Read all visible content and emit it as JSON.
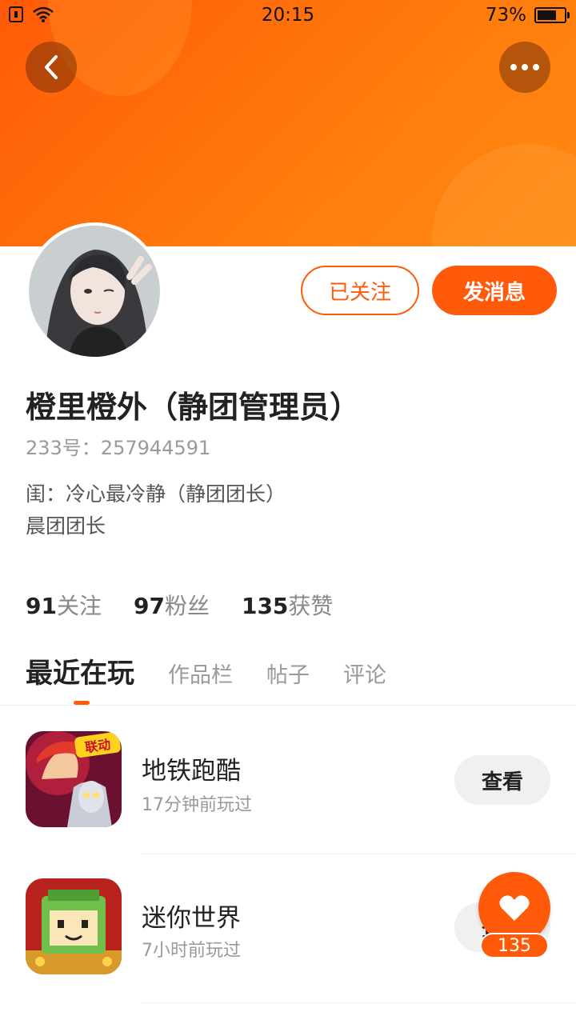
{
  "status_bar": {
    "time": "20:15",
    "battery": "73%",
    "battery_level": 0.73
  },
  "profile": {
    "name": "橙里橙外（静团管理员）",
    "uid": "233号：257944591",
    "bio_line1": "闺：冷心最冷静（静团团长）",
    "bio_line2": "晨团团长",
    "follow_button": "已关注",
    "message_button": "发消息"
  },
  "stats": [
    {
      "num": "91",
      "label": "关注"
    },
    {
      "num": "97",
      "label": "粉丝"
    },
    {
      "num": "135",
      "label": "获赞"
    }
  ],
  "tabs": [
    "最近在玩",
    "作品栏",
    "帖子",
    "评论"
  ],
  "games": [
    {
      "title": "地铁跑酷",
      "sub": "17分钟前玩过",
      "button": "查看",
      "badge": "联动"
    },
    {
      "title": "迷你世界",
      "sub": "7小时前玩过",
      "button": "查看"
    }
  ],
  "like_fab": {
    "count": "135"
  },
  "colors": {
    "accent": "#ff5a0a",
    "header_start": "#ff5a08",
    "header_end": "#ff8a12"
  }
}
